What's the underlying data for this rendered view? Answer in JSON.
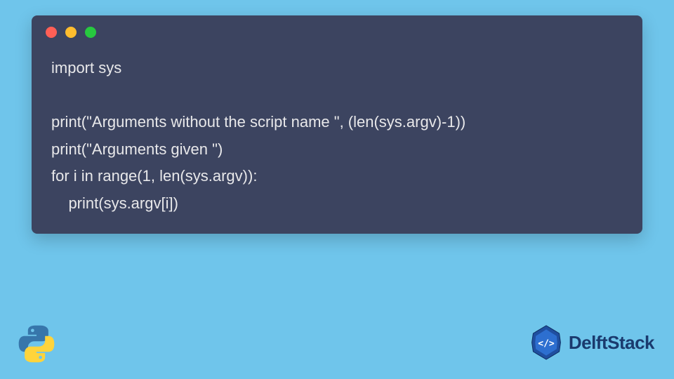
{
  "code": {
    "line1": "import sys",
    "line2": "",
    "line3": "print(\"Arguments without the script name \", (len(sys.argv)-1))",
    "line4": "print(\"Arguments given \")",
    "line5": "for i in range(1, len(sys.argv)):",
    "line6": "    print(sys.argv[i])"
  },
  "brand": {
    "name": "DelftStack"
  }
}
